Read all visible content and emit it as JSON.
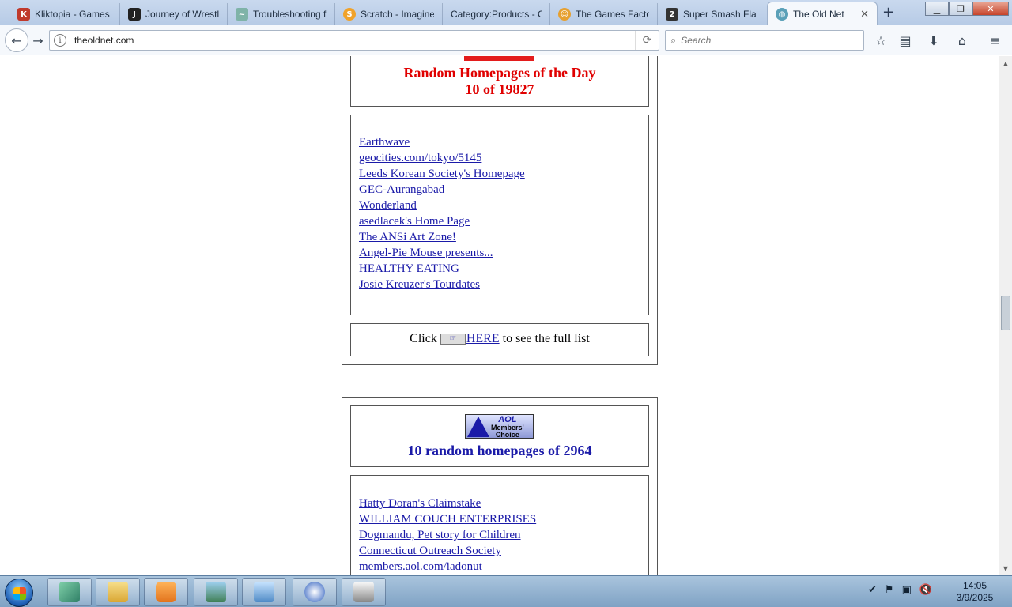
{
  "browser": {
    "tabs": [
      {
        "title": "Kliktopia - Games",
        "icon": "kliktopia-icon",
        "color": "#c0392b",
        "glyph": "K"
      },
      {
        "title": "Journey of Wrestli",
        "icon": "journey-icon",
        "color": "#222222",
        "glyph": "J"
      },
      {
        "title": "Troubleshooting f",
        "icon": "troubleshooting-icon",
        "color": "#7fb3a8",
        "glyph": "~"
      },
      {
        "title": "Scratch - Imagine",
        "icon": "scratch-icon",
        "color": "#f0a22a",
        "glyph": "S"
      },
      {
        "title": "Category:Products - C",
        "icon": "",
        "color": "",
        "glyph": ""
      },
      {
        "title": "The Games Factor",
        "icon": "games-factory-icon",
        "color": "#e6a030",
        "glyph": "☺"
      },
      {
        "title": "Super Smash Flas",
        "icon": "ssf-icon",
        "color": "#333333",
        "glyph": "2"
      },
      {
        "title": "The Old Net",
        "icon": "globe-icon",
        "color": "#5aa0b8",
        "glyph": "◍"
      }
    ],
    "new_tab": "+",
    "url": "theoldnet.com",
    "search_placeholder": "Search"
  },
  "page": {
    "random_day": {
      "title": "Random Homepages of the Day",
      "subtitle": "10 of 19827",
      "links": [
        "Earthwave",
        "geocities.com/tokyo/5145",
        "Leeds Korean Society's Homepage",
        "GEC-Aurangabad",
        "Wonderland",
        "asedlacek's Home Page",
        "The ANSi Art Zone!",
        "Angel-Pie Mouse presents...",
        "HEALTHY EATING",
        "Josie Kreuzer's Tourdates"
      ],
      "click_prefix": "Click",
      "here_label": "HERE",
      "click_suffix": " to see the full list"
    },
    "aol": {
      "logo_top": "AOL",
      "logo_line1": "Members'",
      "logo_line2": "Choice",
      "heading": "10 random homepages of 2964",
      "links": [
        "Hatty Doran's Claimstake",
        "WILLIAM COUCH ENTERPRISES",
        "Dogmandu, Pet story for Children",
        "Connecticut Outreach Society",
        "members.aol.com/iadonut"
      ]
    }
  },
  "taskbar": {
    "time": "14:05",
    "date": "3/9/2025"
  }
}
